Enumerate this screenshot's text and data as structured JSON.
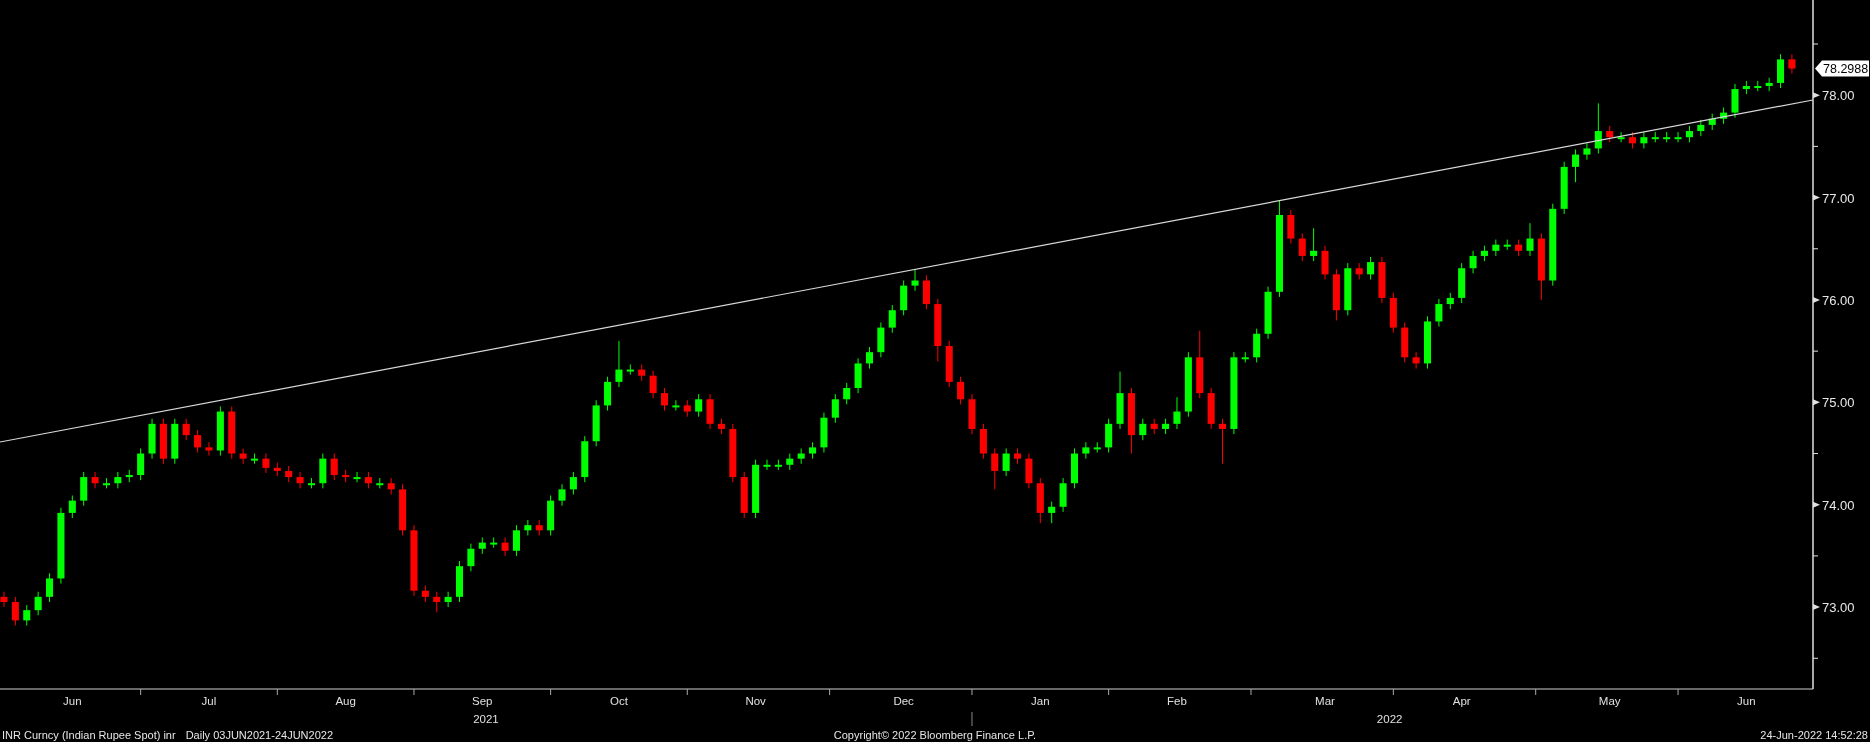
{
  "chart": {
    "last_price": "78.2988",
    "years": [
      "2021",
      "2022"
    ],
    "chart_data": {
      "type": "candlestick",
      "ylim": [
        72.2,
        78.93
      ],
      "yticks": [
        {
          "value": 73,
          "label": "73.00"
        },
        {
          "value": 74,
          "label": "74.00"
        },
        {
          "value": 75,
          "label": "75.00"
        },
        {
          "value": 76,
          "label": "76.00"
        },
        {
          "value": 77,
          "label": "77.00"
        },
        {
          "value": 78,
          "label": "78.00"
        }
      ],
      "categories": [
        null,
        null,
        null,
        null,
        null,
        null,
        "Jun",
        null,
        null,
        null,
        null,
        null,
        null,
        null,
        null,
        null,
        null,
        null,
        "Jul",
        null,
        null,
        null,
        null,
        null,
        null,
        null,
        null,
        null,
        null,
        null,
        "Aug",
        null,
        null,
        null,
        null,
        null,
        null,
        null,
        null,
        null,
        null,
        null,
        "Sep",
        null,
        null,
        null,
        null,
        null,
        null,
        null,
        null,
        null,
        null,
        null,
        "Oct",
        null,
        null,
        null,
        null,
        null,
        null,
        null,
        null,
        null,
        null,
        null,
        "Nov",
        null,
        null,
        null,
        null,
        null,
        null,
        null,
        null,
        null,
        null,
        null,
        null,
        "Dec",
        null,
        null,
        null,
        null,
        null,
        null,
        null,
        null,
        null,
        null,
        null,
        "Jan",
        null,
        null,
        null,
        null,
        null,
        null,
        null,
        null,
        null,
        null,
        null,
        "Feb",
        null,
        null,
        null,
        null,
        null,
        null,
        null,
        null,
        null,
        null,
        null,
        null,
        "Mar",
        null,
        null,
        null,
        null,
        null,
        null,
        null,
        null,
        null,
        null,
        null,
        "Apr",
        null,
        null,
        null,
        null,
        null,
        null,
        null,
        null,
        null,
        null,
        null,
        null,
        "May",
        null,
        null,
        null,
        null,
        null,
        null,
        null,
        null,
        null,
        null,
        null,
        "Jun",
        null,
        null,
        null,
        null
      ],
      "ohlc": [
        [
          73.1,
          73.15,
          73.0,
          73.05
        ],
        [
          73.05,
          73.1,
          72.82,
          72.87
        ],
        [
          72.87,
          73.02,
          72.82,
          72.97
        ],
        [
          72.97,
          73.15,
          72.92,
          73.1
        ],
        [
          73.1,
          73.33,
          73.05,
          73.28
        ],
        [
          73.28,
          73.97,
          73.23,
          73.92
        ],
        [
          73.92,
          74.09,
          73.87,
          74.04
        ],
        [
          74.04,
          74.32,
          73.99,
          74.27
        ],
        [
          74.27,
          74.32,
          74.16,
          74.21
        ],
        [
          74.21,
          74.26,
          74.16,
          74.21
        ],
        [
          74.21,
          74.32,
          74.16,
          74.27
        ],
        [
          74.27,
          74.34,
          74.22,
          74.29
        ],
        [
          74.29,
          74.55,
          74.24,
          74.5
        ],
        [
          74.5,
          74.84,
          74.45,
          74.79
        ],
        [
          74.79,
          74.84,
          74.4,
          74.45
        ],
        [
          74.45,
          74.84,
          74.4,
          74.79
        ],
        [
          74.79,
          74.84,
          74.63,
          74.68
        ],
        [
          74.68,
          74.73,
          74.51,
          74.56
        ],
        [
          74.56,
          74.61,
          74.48,
          74.53
        ],
        [
          74.53,
          74.96,
          74.48,
          74.91
        ],
        [
          74.91,
          74.96,
          74.45,
          74.5
        ],
        [
          74.5,
          74.55,
          74.4,
          74.45
        ],
        [
          74.45,
          74.5,
          74.4,
          74.45
        ],
        [
          74.45,
          74.5,
          74.31,
          74.36
        ],
        [
          74.36,
          74.41,
          74.28,
          74.33
        ],
        [
          74.33,
          74.38,
          74.22,
          74.27
        ],
        [
          74.27,
          74.32,
          74.16,
          74.21
        ],
        [
          74.21,
          74.26,
          74.16,
          74.21
        ],
        [
          74.21,
          74.5,
          74.16,
          74.45
        ],
        [
          74.45,
          74.5,
          74.24,
          74.29
        ],
        [
          74.29,
          74.34,
          74.22,
          74.27
        ],
        [
          74.27,
          74.32,
          74.22,
          74.27
        ],
        [
          74.27,
          74.32,
          74.16,
          74.21
        ],
        [
          74.21,
          74.26,
          74.16,
          74.21
        ],
        [
          74.21,
          74.26,
          74.1,
          74.15
        ],
        [
          74.15,
          74.2,
          73.7,
          73.75
        ],
        [
          73.75,
          73.8,
          73.11,
          73.16
        ],
        [
          73.16,
          73.21,
          73.05,
          73.1
        ],
        [
          73.1,
          73.15,
          72.95,
          73.05
        ],
        [
          73.05,
          73.15,
          73.0,
          73.1
        ],
        [
          73.1,
          73.45,
          73.05,
          73.4
        ],
        [
          73.4,
          73.62,
          73.35,
          73.57
        ],
        [
          73.57,
          73.68,
          73.52,
          73.63
        ],
        [
          73.63,
          73.68,
          73.58,
          73.63
        ],
        [
          73.63,
          73.68,
          73.5,
          73.55
        ],
        [
          73.55,
          73.8,
          73.5,
          73.75
        ],
        [
          73.75,
          73.85,
          73.7,
          73.8
        ],
        [
          73.8,
          73.85,
          73.7,
          73.75
        ],
        [
          73.75,
          74.09,
          73.7,
          74.04
        ],
        [
          74.04,
          74.2,
          73.99,
          74.15
        ],
        [
          74.15,
          74.32,
          74.1,
          74.27
        ],
        [
          74.27,
          74.67,
          74.22,
          74.62
        ],
        [
          74.62,
          75.02,
          74.57,
          74.97
        ],
        [
          74.97,
          75.25,
          74.92,
          75.2
        ],
        [
          75.2,
          75.6,
          75.15,
          75.32
        ],
        [
          75.32,
          75.37,
          75.27,
          75.32
        ],
        [
          75.32,
          75.37,
          75.21,
          75.26
        ],
        [
          75.26,
          75.31,
          75.04,
          75.09
        ],
        [
          75.09,
          75.14,
          74.92,
          74.97
        ],
        [
          74.97,
          75.02,
          74.92,
          74.97
        ],
        [
          74.97,
          75.02,
          74.86,
          74.91
        ],
        [
          74.91,
          75.08,
          74.86,
          75.03
        ],
        [
          75.03,
          75.08,
          74.74,
          74.79
        ],
        [
          74.79,
          74.84,
          74.69,
          74.74
        ],
        [
          74.74,
          74.79,
          74.22,
          74.27
        ],
        [
          74.27,
          74.32,
          73.87,
          73.92
        ],
        [
          73.92,
          74.44,
          73.87,
          74.39
        ],
        [
          74.39,
          74.44,
          74.34,
          74.39
        ],
        [
          74.39,
          74.44,
          74.34,
          74.39
        ],
        [
          74.39,
          74.5,
          74.34,
          74.45
        ],
        [
          74.45,
          74.55,
          74.4,
          74.5
        ],
        [
          74.5,
          74.61,
          74.45,
          74.56
        ],
        [
          74.56,
          74.9,
          74.51,
          74.85
        ],
        [
          74.85,
          75.08,
          74.8,
          75.03
        ],
        [
          75.03,
          75.19,
          74.98,
          75.14
        ],
        [
          75.14,
          75.43,
          75.09,
          75.38
        ],
        [
          75.38,
          75.54,
          75.33,
          75.49
        ],
        [
          75.49,
          75.78,
          75.44,
          75.73
        ],
        [
          75.73,
          75.95,
          75.68,
          75.9
        ],
        [
          75.9,
          76.19,
          75.85,
          76.14
        ],
        [
          76.14,
          76.3,
          76.09,
          76.19
        ],
        [
          76.19,
          76.24,
          75.91,
          75.96
        ],
        [
          75.96,
          76.01,
          75.4,
          75.55
        ],
        [
          75.55,
          75.6,
          75.15,
          75.2
        ],
        [
          75.2,
          75.25,
          74.98,
          75.03
        ],
        [
          75.03,
          75.08,
          74.69,
          74.74
        ],
        [
          74.74,
          74.79,
          74.45,
          74.5
        ],
        [
          74.5,
          74.55,
          74.15,
          74.33
        ],
        [
          74.33,
          74.55,
          74.28,
          74.5
        ],
        [
          74.5,
          74.55,
          74.4,
          74.45
        ],
        [
          74.45,
          74.5,
          74.16,
          74.21
        ],
        [
          74.21,
          74.26,
          73.82,
          73.92
        ],
        [
          73.92,
          74.03,
          73.82,
          73.98
        ],
        [
          73.98,
          74.26,
          73.93,
          74.21
        ],
        [
          74.21,
          74.55,
          74.16,
          74.5
        ],
        [
          74.5,
          74.61,
          74.45,
          74.56
        ],
        [
          74.56,
          74.61,
          74.51,
          74.56
        ],
        [
          74.56,
          74.84,
          74.51,
          74.79
        ],
        [
          74.79,
          75.3,
          74.74,
          75.09
        ],
        [
          75.09,
          75.14,
          74.5,
          74.68
        ],
        [
          74.68,
          74.84,
          74.63,
          74.79
        ],
        [
          74.79,
          74.84,
          74.69,
          74.74
        ],
        [
          74.74,
          74.84,
          74.69,
          74.79
        ],
        [
          74.79,
          75.05,
          74.74,
          74.91
        ],
        [
          74.91,
          75.49,
          74.86,
          75.44
        ],
        [
          75.44,
          75.7,
          75.04,
          75.09
        ],
        [
          75.09,
          75.14,
          74.74,
          74.79
        ],
        [
          74.79,
          74.84,
          74.4,
          74.74
        ],
        [
          74.74,
          75.49,
          74.69,
          75.44
        ],
        [
          75.44,
          75.49,
          75.39,
          75.44
        ],
        [
          75.44,
          75.72,
          75.39,
          75.67
        ],
        [
          75.67,
          76.13,
          75.62,
          76.08
        ],
        [
          76.08,
          76.97,
          76.03,
          76.83
        ],
        [
          76.83,
          76.88,
          76.55,
          76.6
        ],
        [
          76.6,
          76.65,
          76.38,
          76.43
        ],
        [
          76.43,
          76.7,
          76.38,
          76.48
        ],
        [
          76.48,
          76.53,
          76.2,
          76.25
        ],
        [
          76.25,
          76.3,
          75.8,
          75.9
        ],
        [
          75.9,
          76.36,
          75.85,
          76.31
        ],
        [
          76.31,
          76.36,
          76.2,
          76.25
        ],
        [
          76.25,
          76.42,
          76.2,
          76.37
        ],
        [
          76.37,
          76.42,
          75.97,
          76.02
        ],
        [
          76.02,
          76.07,
          75.68,
          75.73
        ],
        [
          75.73,
          75.78,
          75.39,
          75.44
        ],
        [
          75.44,
          75.49,
          75.33,
          75.38
        ],
        [
          75.38,
          75.84,
          75.33,
          75.79
        ],
        [
          75.79,
          76.01,
          75.74,
          75.96
        ],
        [
          75.96,
          76.07,
          75.91,
          76.02
        ],
        [
          76.02,
          76.36,
          75.97,
          76.31
        ],
        [
          76.31,
          76.48,
          76.26,
          76.43
        ],
        [
          76.43,
          76.53,
          76.38,
          76.48
        ],
        [
          76.48,
          76.59,
          76.43,
          76.54
        ],
        [
          76.54,
          76.59,
          76.49,
          76.54
        ],
        [
          76.54,
          76.59,
          76.43,
          76.48
        ],
        [
          76.48,
          76.75,
          76.43,
          76.6
        ],
        [
          76.6,
          76.65,
          76.0,
          76.19
        ],
        [
          76.19,
          76.94,
          76.14,
          76.89
        ],
        [
          76.89,
          77.35,
          76.84,
          77.3
        ],
        [
          77.3,
          77.47,
          77.15,
          77.42
        ],
        [
          77.42,
          77.53,
          77.37,
          77.48
        ],
        [
          77.48,
          77.92,
          77.43,
          77.65
        ],
        [
          77.65,
          77.7,
          77.54,
          77.59
        ],
        [
          77.59,
          77.64,
          77.54,
          77.59
        ],
        [
          77.59,
          77.64,
          77.48,
          77.53
        ],
        [
          77.53,
          77.64,
          77.48,
          77.59
        ],
        [
          77.59,
          77.64,
          77.54,
          77.59
        ],
        [
          77.59,
          77.64,
          77.54,
          77.59
        ],
        [
          77.59,
          77.64,
          77.54,
          77.59
        ],
        [
          77.59,
          77.7,
          77.54,
          77.65
        ],
        [
          77.65,
          77.76,
          77.6,
          77.71
        ],
        [
          77.71,
          77.82,
          77.66,
          77.77
        ],
        [
          77.77,
          77.88,
          77.72,
          77.83
        ],
        [
          77.83,
          78.11,
          77.78,
          78.06
        ],
        [
          78.06,
          78.14,
          78.01,
          78.09
        ],
        [
          78.09,
          78.14,
          78.04,
          78.09
        ],
        [
          78.09,
          78.17,
          78.04,
          78.12
        ],
        [
          78.12,
          78.4,
          78.07,
          78.35
        ],
        [
          78.35,
          78.4,
          78.21,
          78.26
        ]
      ]
    }
  },
  "footer": {
    "security": "INR Curncy (Indian Rupee Spot) inr",
    "period": "Daily 03JUN2021-24JUN2022",
    "copyright": "Copyright© 2022 Bloomberg Finance L.P.",
    "timestamp": "24-Jun-2022 14:52:28"
  }
}
